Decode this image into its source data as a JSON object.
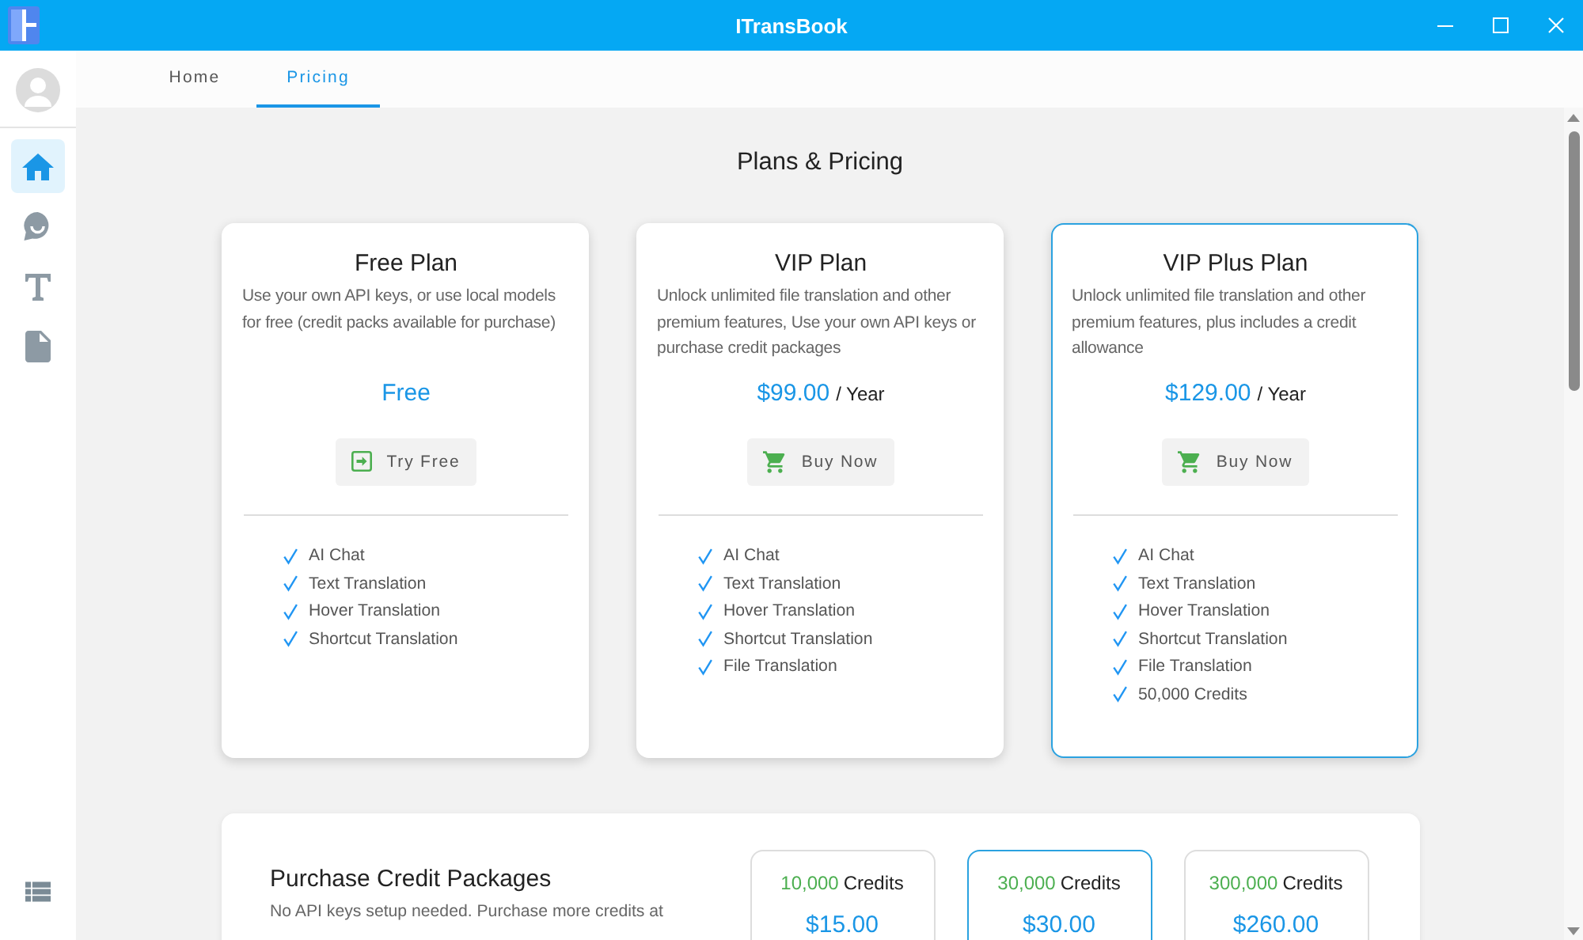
{
  "window": {
    "title": "ITransBook"
  },
  "sidebar": {
    "items": [
      {
        "kind": "home",
        "selected": true
      },
      {
        "kind": "chat",
        "selected": false
      },
      {
        "kind": "text",
        "selected": false
      },
      {
        "kind": "file",
        "selected": false
      }
    ]
  },
  "tabs": [
    {
      "label": "Home",
      "selected": false
    },
    {
      "label": "Pricing",
      "selected": true
    }
  ],
  "heading": "Plans & Pricing",
  "plans": [
    {
      "name": "Free Plan",
      "description": "Use your own API keys, or use local models for free (credit packs available for purchase)",
      "price": "Free",
      "button": {
        "kind": "try",
        "label": "Try Free"
      },
      "features": [
        "AI Chat",
        "Text Translation",
        "Hover Translation",
        "Shortcut Translation"
      ],
      "selected": false
    },
    {
      "name": "VIP Plan",
      "description": "Unlock unlimited file translation and other premium features, Use your own API keys or purchase credit packages",
      "price": "$99.00",
      "period": "/ Year",
      "button": {
        "kind": "buy",
        "label": "Buy Now"
      },
      "features": [
        "AI Chat",
        "Text Translation",
        "Hover Translation",
        "Shortcut Translation",
        "File Translation"
      ],
      "selected": false
    },
    {
      "name": "VIP Plus Plan",
      "description": "Unlock unlimited file translation and other premium features, plus includes a credit allowance",
      "price": "$129.00",
      "period": "/ Year",
      "button": {
        "kind": "buy",
        "label": "Buy Now"
      },
      "features": [
        "AI Chat",
        "Text Translation",
        "Hover Translation",
        "Shortcut Translation",
        "File Translation",
        "50,000 Credits"
      ],
      "selected": true
    }
  ],
  "credits": {
    "title": "Purchase Credit Packages",
    "description": "No API keys setup needed. Purchase more credits at",
    "packages": [
      {
        "amount": "10,000",
        "unit": "Credits",
        "price": "$15.00",
        "selected": false
      },
      {
        "amount": "30,000",
        "unit": "Credits",
        "price": "$30.00",
        "selected": true
      },
      {
        "amount": "300,000",
        "unit": "Credits",
        "price": "$260.00",
        "selected": false
      }
    ]
  }
}
